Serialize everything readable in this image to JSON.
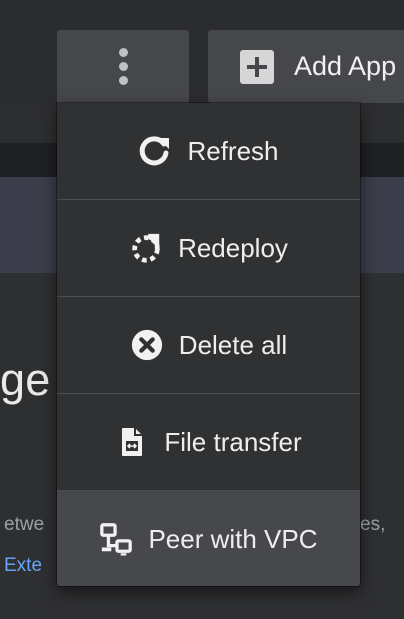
{
  "toolbar": {
    "more_icon": "more-vertical-icon",
    "add_app_label": "Add App",
    "add_icon": "plus-square-icon"
  },
  "dropdown": {
    "items": [
      {
        "label": "Refresh",
        "icon": "refresh-icon"
      },
      {
        "label": "Redeploy",
        "icon": "redeploy-icon"
      },
      {
        "label": "Delete all",
        "icon": "delete-circle-icon"
      },
      {
        "label": "File transfer",
        "icon": "file-transfer-icon"
      },
      {
        "label": "Peer with VPC",
        "icon": "network-peer-icon"
      }
    ]
  },
  "background": {
    "heading_fragment": "ge",
    "description_left": "etwe",
    "description_right": "es,",
    "link_fragment": "Exte"
  },
  "colors": {
    "menu_bg": "#303133",
    "menu_active_bg": "#46484c",
    "toolbar_button_bg": "#45474b",
    "link": "#6aa3f5"
  }
}
